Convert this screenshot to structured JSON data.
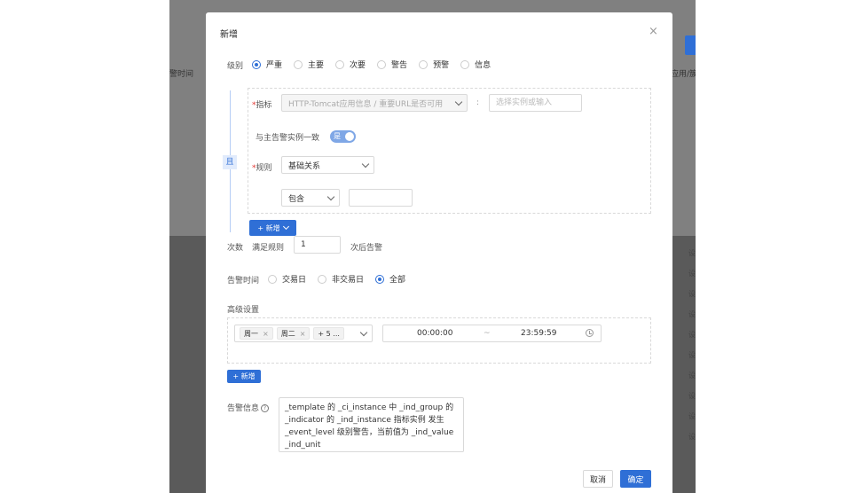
{
  "background": {
    "col_time": "警时间",
    "col_app": "应用/簇",
    "row_text": "设"
  },
  "modal": {
    "title": "新增",
    "close_icon": "×",
    "level": {
      "label": "级别",
      "options": [
        "严重",
        "主要",
        "次要",
        "警告",
        "预警",
        "信息"
      ],
      "selected": "严重"
    },
    "condition": {
      "and_tag": "且",
      "metric_label": "指标",
      "metric_value": "HTTP-Tomcat应用信息 / 重要URL是否可用",
      "colon": ":",
      "instance_placeholder": "选择实例或输入",
      "consistent_label": "与主告警实例一致",
      "consistent_switch_text": "是",
      "rule_label": "规则",
      "rule_value": "基础关系",
      "operator_value": "包含",
      "add_button": "+ 新增"
    },
    "count": {
      "label": "次数",
      "prefix": "满足规则",
      "value": "1",
      "suffix": "次后告警"
    },
    "alarm_time": {
      "label": "告警时间",
      "options": [
        "交易日",
        "非交易日",
        "全部"
      ],
      "selected": "全部"
    },
    "advanced": {
      "label": "高级设置",
      "day_tags": [
        "周一",
        "周二"
      ],
      "more_tag": "+ 5 ...",
      "start_time": "00:00:00",
      "separator": "~",
      "end_time": "23:59:59",
      "add_button": "+ 新增"
    },
    "alarm_info": {
      "label": "告警信息",
      "help": "?",
      "text": "_template 的 _ci_instance 中 _ind_group 的\n_indicator 的 _ind_instance 指标实例 发生\n_event_level 级别警告，当前值为 _ind_value\n_ind_unit"
    },
    "footer": {
      "cancel": "取消",
      "confirm": "确定"
    }
  }
}
